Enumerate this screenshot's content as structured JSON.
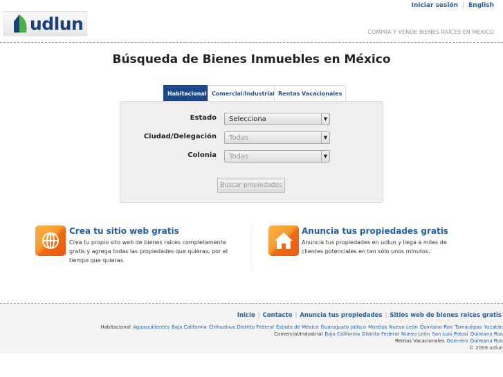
{
  "header": {
    "logo_text": "udlun",
    "login": "Iniciar sesión",
    "language": "English",
    "tagline": "COMPRA Y VENDE BIENES RAÍCES EN MÉXICO"
  },
  "title": "Búsqueda de Bienes Inmuebles en México",
  "tabs": [
    {
      "label": "Habitacional"
    },
    {
      "label": "Comercial/Industrial"
    },
    {
      "label": "Rentas Vacacionales"
    }
  ],
  "form": {
    "estado_label": "Estado",
    "estado_value": "Selecciona",
    "ciudad_label": "Ciudad/Delegación",
    "ciudad_value": "Todas",
    "colonia_label": "Colonia",
    "colonia_value": "Todas",
    "search_button": "Buscar propiedades"
  },
  "promos": [
    {
      "title": "Crea tu sitio web gratis",
      "desc": "Crea tu propio sito web de bienes raices completamente gratis y agrega todas las propiedades que quieras, por el tiempo que quieras."
    },
    {
      "title": "Anuncia tus propiedades gratis",
      "desc": "Anuncia tus propiedades en udlun y llega a miles de clientes potenciales en tan sólo unos minutos."
    }
  ],
  "footer": {
    "links": [
      "Inicio",
      "Contacto",
      "Anuncia tus propiedades",
      "Sitios web de bienes raíces gratis"
    ],
    "habitacional_label": "Habitacional",
    "habitacional": [
      "Aguascalientes",
      "Baja California",
      "Chihuahua",
      "Distrito Federal",
      "Estado de México",
      "Guanajuato",
      "Jalisco",
      "Morelos",
      "Nuevo León",
      "Quintano Roo",
      "Tamaulipas",
      "Yucatán"
    ],
    "comercial_label": "Comercial/Industrial",
    "comercial": [
      "Baja California",
      "Distrito Federal",
      "Nuevo León",
      "San Luis Potosí",
      "Quintano Roo"
    ],
    "rentas_label": "Rentas Vacacionales",
    "rentas": [
      "Guerrero",
      "Quintana Roo"
    ],
    "copyright": "© 2009 udlun"
  }
}
